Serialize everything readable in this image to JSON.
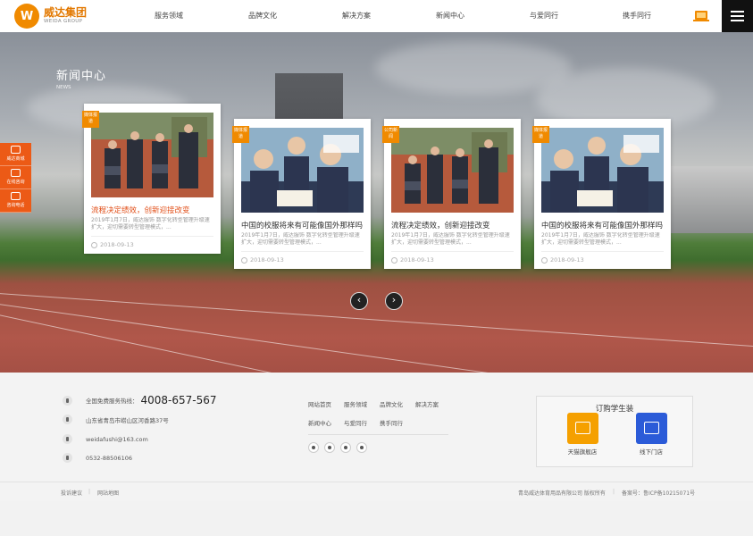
{
  "header": {
    "logo": {
      "badge": "W",
      "name": "威达集团",
      "subname": "WEIDA GROUP"
    },
    "nav": [
      "服务领域",
      "品牌文化",
      "解决方案",
      "新闻中心",
      "与爱同行",
      "携手同行"
    ]
  },
  "hero": {
    "title": "新闻中心",
    "subtitle": "NEWS",
    "cards": [
      {
        "tag": "媒体报道",
        "title": "流程决定绩效，创新迎接改变",
        "desc": "2019年1月7日，威达服饰 数字化转型管理升级速扩大，迎切需要转型管理模式，...",
        "date": "2018-09-13"
      },
      {
        "tag": "媒体报道",
        "title": "中国的校服将来有可能像国外那样吗",
        "desc": "2019年1月7日，威达服饰 数字化转型管理升级速扩大，迎切需要转型管理模式，...",
        "date": "2018-09-13"
      },
      {
        "tag": "公司新闻",
        "title": "流程决定绩效，创新迎接改变",
        "desc": "2019年1月7日，威达服饰 数字化转型管理升级速扩大，迎切需要转型管理模式，...",
        "date": "2018-09-13"
      },
      {
        "tag": "媒体报道",
        "title": "中国的校服将来有可能像国外那样吗",
        "desc": "2019年1月7日，威达服饰 数字化转型管理升级速扩大，迎切需要转型管理模式，...",
        "date": "2018-09-13"
      }
    ],
    "prev_arrow": "‹",
    "next_arrow": "›"
  },
  "side_tools": [
    "威达商城",
    "在线咨询",
    "咨询电话"
  ],
  "footer": {
    "hotline_label": "全国免费服务热线：",
    "hotline": "4008-657-567",
    "address": "山东省青岛市崂山区河香路37号",
    "email": "weidafushi@163.com",
    "phone": "0532-88506106",
    "links": [
      "网站首页",
      "服务领域",
      "品牌文化",
      "解决方案",
      "新闻中心",
      "与爱同行",
      "携手同行"
    ],
    "buy_title": "订购学生装",
    "shops": [
      {
        "label": "天猫旗舰店",
        "color": "#f5a000"
      },
      {
        "label": "线下门店",
        "color": "#2b5bd8"
      }
    ]
  },
  "bottom": {
    "complaint": "投诉建议",
    "sitemap": "网站地图",
    "copyright": "青岛威达体育用品有限公司 版权所有",
    "icp": "备案号：鲁ICP备10215071号"
  }
}
